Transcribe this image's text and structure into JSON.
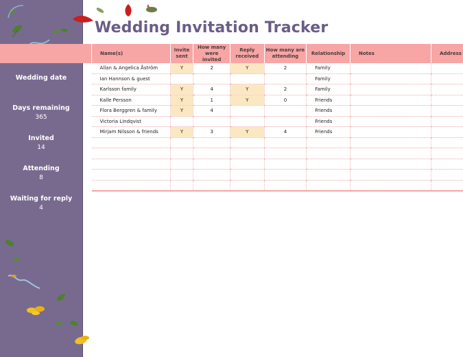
{
  "title": "Wedding Invitation Tracker",
  "sidebar": {
    "stats": [
      {
        "label": "Wedding date",
        "value": ""
      },
      {
        "label": "Days remaining",
        "value": "365"
      },
      {
        "label": "Invited",
        "value": "14"
      },
      {
        "label": "Attending",
        "value": "8"
      },
      {
        "label": "Waiting for reply",
        "value": "4"
      }
    ]
  },
  "table": {
    "headers": {
      "name": "Name(s)",
      "invite_sent": "Invite sent",
      "how_many_invited": "How many were invited",
      "reply_received": "Reply received",
      "how_many_attending": "How many are attending",
      "relationship": "Relationship",
      "notes": "Notes",
      "address": "Address"
    },
    "rows": [
      {
        "name": "Allan & Angelica Åström",
        "invite_sent": "Y",
        "invited": "2",
        "reply": "Y",
        "attending": "2",
        "relationship": "Family",
        "notes": "",
        "address": ""
      },
      {
        "name": "Ian Hannson & guest",
        "invite_sent": "",
        "invited": "",
        "reply": "",
        "attending": "",
        "relationship": "Family",
        "notes": "",
        "address": ""
      },
      {
        "name": "Karlsson family",
        "invite_sent": "Y",
        "invited": "4",
        "reply": "Y",
        "attending": "2",
        "relationship": "Family",
        "notes": "",
        "address": ""
      },
      {
        "name": "Kalle Persson",
        "invite_sent": "Y",
        "invited": "1",
        "reply": "Y",
        "attending": "0",
        "relationship": "Friends",
        "notes": "",
        "address": ""
      },
      {
        "name": "Flora Berggren & family",
        "invite_sent": "Y",
        "invited": "4",
        "reply": "",
        "attending": "",
        "relationship": "Friends",
        "notes": "",
        "address": ""
      },
      {
        "name": "Victoria Lindqvist",
        "invite_sent": "",
        "invited": "",
        "reply": "",
        "attending": "",
        "relationship": "Friends",
        "notes": "",
        "address": ""
      },
      {
        "name": "Mirjam Nilsson & friends",
        "invite_sent": "Y",
        "invited": "3",
        "reply": "Y",
        "attending": "4",
        "relationship": "Friends",
        "notes": "",
        "address": ""
      },
      {
        "name": "",
        "invite_sent": "",
        "invited": "",
        "reply": "",
        "attending": "",
        "relationship": "",
        "notes": "",
        "address": ""
      },
      {
        "name": "",
        "invite_sent": "",
        "invited": "",
        "reply": "",
        "attending": "",
        "relationship": "",
        "notes": "",
        "address": ""
      },
      {
        "name": "",
        "invite_sent": "",
        "invited": "",
        "reply": "",
        "attending": "",
        "relationship": "",
        "notes": "",
        "address": ""
      },
      {
        "name": "",
        "invite_sent": "",
        "invited": "",
        "reply": "",
        "attending": "",
        "relationship": "",
        "notes": "",
        "address": ""
      },
      {
        "name": "",
        "invite_sent": "",
        "invited": "",
        "reply": "",
        "attending": "",
        "relationship": "",
        "notes": "",
        "address": ""
      }
    ]
  },
  "colors": {
    "sidebar": "#786a8f",
    "header_band": "#f7a5a5",
    "title": "#6a5d86",
    "yes_cell": "#fbe8c2"
  },
  "decor": {
    "icons": [
      "leaf-icon",
      "petal-icon",
      "bird-icon",
      "ribbon-icon",
      "flower-icon"
    ]
  }
}
